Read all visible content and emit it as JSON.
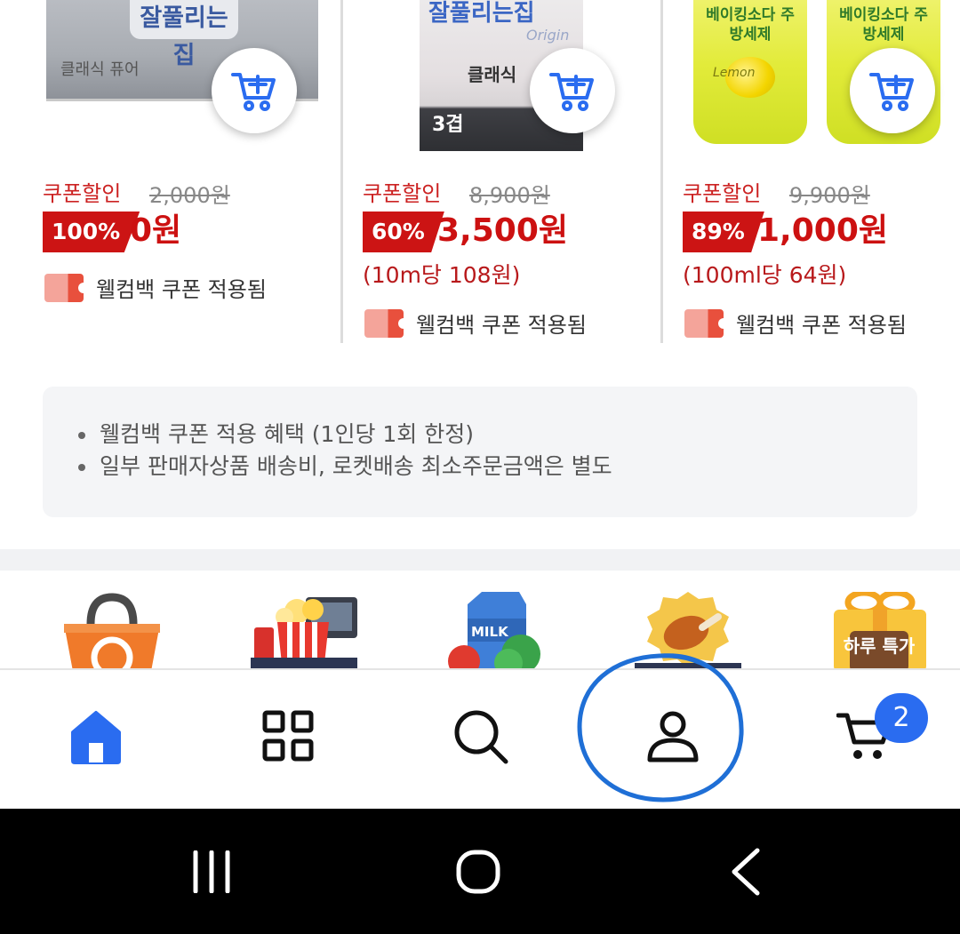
{
  "products": [
    {
      "image_label": "잘풀리는집",
      "image_sublabel": "클래식 퓨어",
      "coupon_label": "쿠폰할인",
      "original_price": "2,000원",
      "discount": "100%",
      "sale_price": "0원",
      "unit_price": "",
      "coupon_applied": "웰컴백 쿠폰 적용됨"
    },
    {
      "image_label": "잘풀리는집",
      "image_sublabel": "Origin",
      "image_sublabel2": "클래식",
      "image_sublabel3": "3겹",
      "coupon_label": "쿠폰할인",
      "original_price": "8,900원",
      "discount": "60%",
      "sale_price": "3,500원",
      "unit_price": "(10m당 108원)",
      "coupon_applied": "웰컴백 쿠폰 적용됨"
    },
    {
      "image_label": "베이킹소다 주방세제",
      "image_sublabel": "Lemon",
      "coupon_label": "쿠폰할인",
      "original_price": "9,900원",
      "discount": "89%",
      "sale_price": "1,000원",
      "unit_price": "(100ml당 64원)",
      "coupon_applied": "웰컴백 쿠폰 적용됨"
    }
  ],
  "notice": {
    "items": [
      "웰컴백 쿠폰 적용 혜택 (1인당 1회 한정)",
      "일부 판매자상품 배송비, 로켓배송 최소주문금액은 별도"
    ]
  },
  "categories": [
    {
      "icon": "recycle-basket-icon",
      "text": ""
    },
    {
      "icon": "popcorn-tv-icon",
      "text": ""
    },
    {
      "icon": "milk-vegetable-icon",
      "text": ""
    },
    {
      "icon": "chicken-icon",
      "text": ""
    },
    {
      "icon": "gift-box-icon",
      "text": "하루 특가"
    }
  ],
  "tabbar": {
    "tabs": [
      {
        "name": "home",
        "icon": "home-icon",
        "active": true
      },
      {
        "name": "category",
        "icon": "grid-icon",
        "active": false
      },
      {
        "name": "search",
        "icon": "search-icon",
        "active": false
      },
      {
        "name": "my",
        "icon": "user-icon",
        "active": false
      },
      {
        "name": "cart",
        "icon": "cart-icon",
        "active": false
      }
    ],
    "cart_badge": "2"
  },
  "colors": {
    "accent": "#2a6cf0",
    "sale_red": "#cc1414",
    "annotation_circle": "#1f6fd6"
  },
  "system_nav": {
    "buttons": [
      "recent-apps-icon",
      "home-circle-icon",
      "back-icon"
    ]
  }
}
